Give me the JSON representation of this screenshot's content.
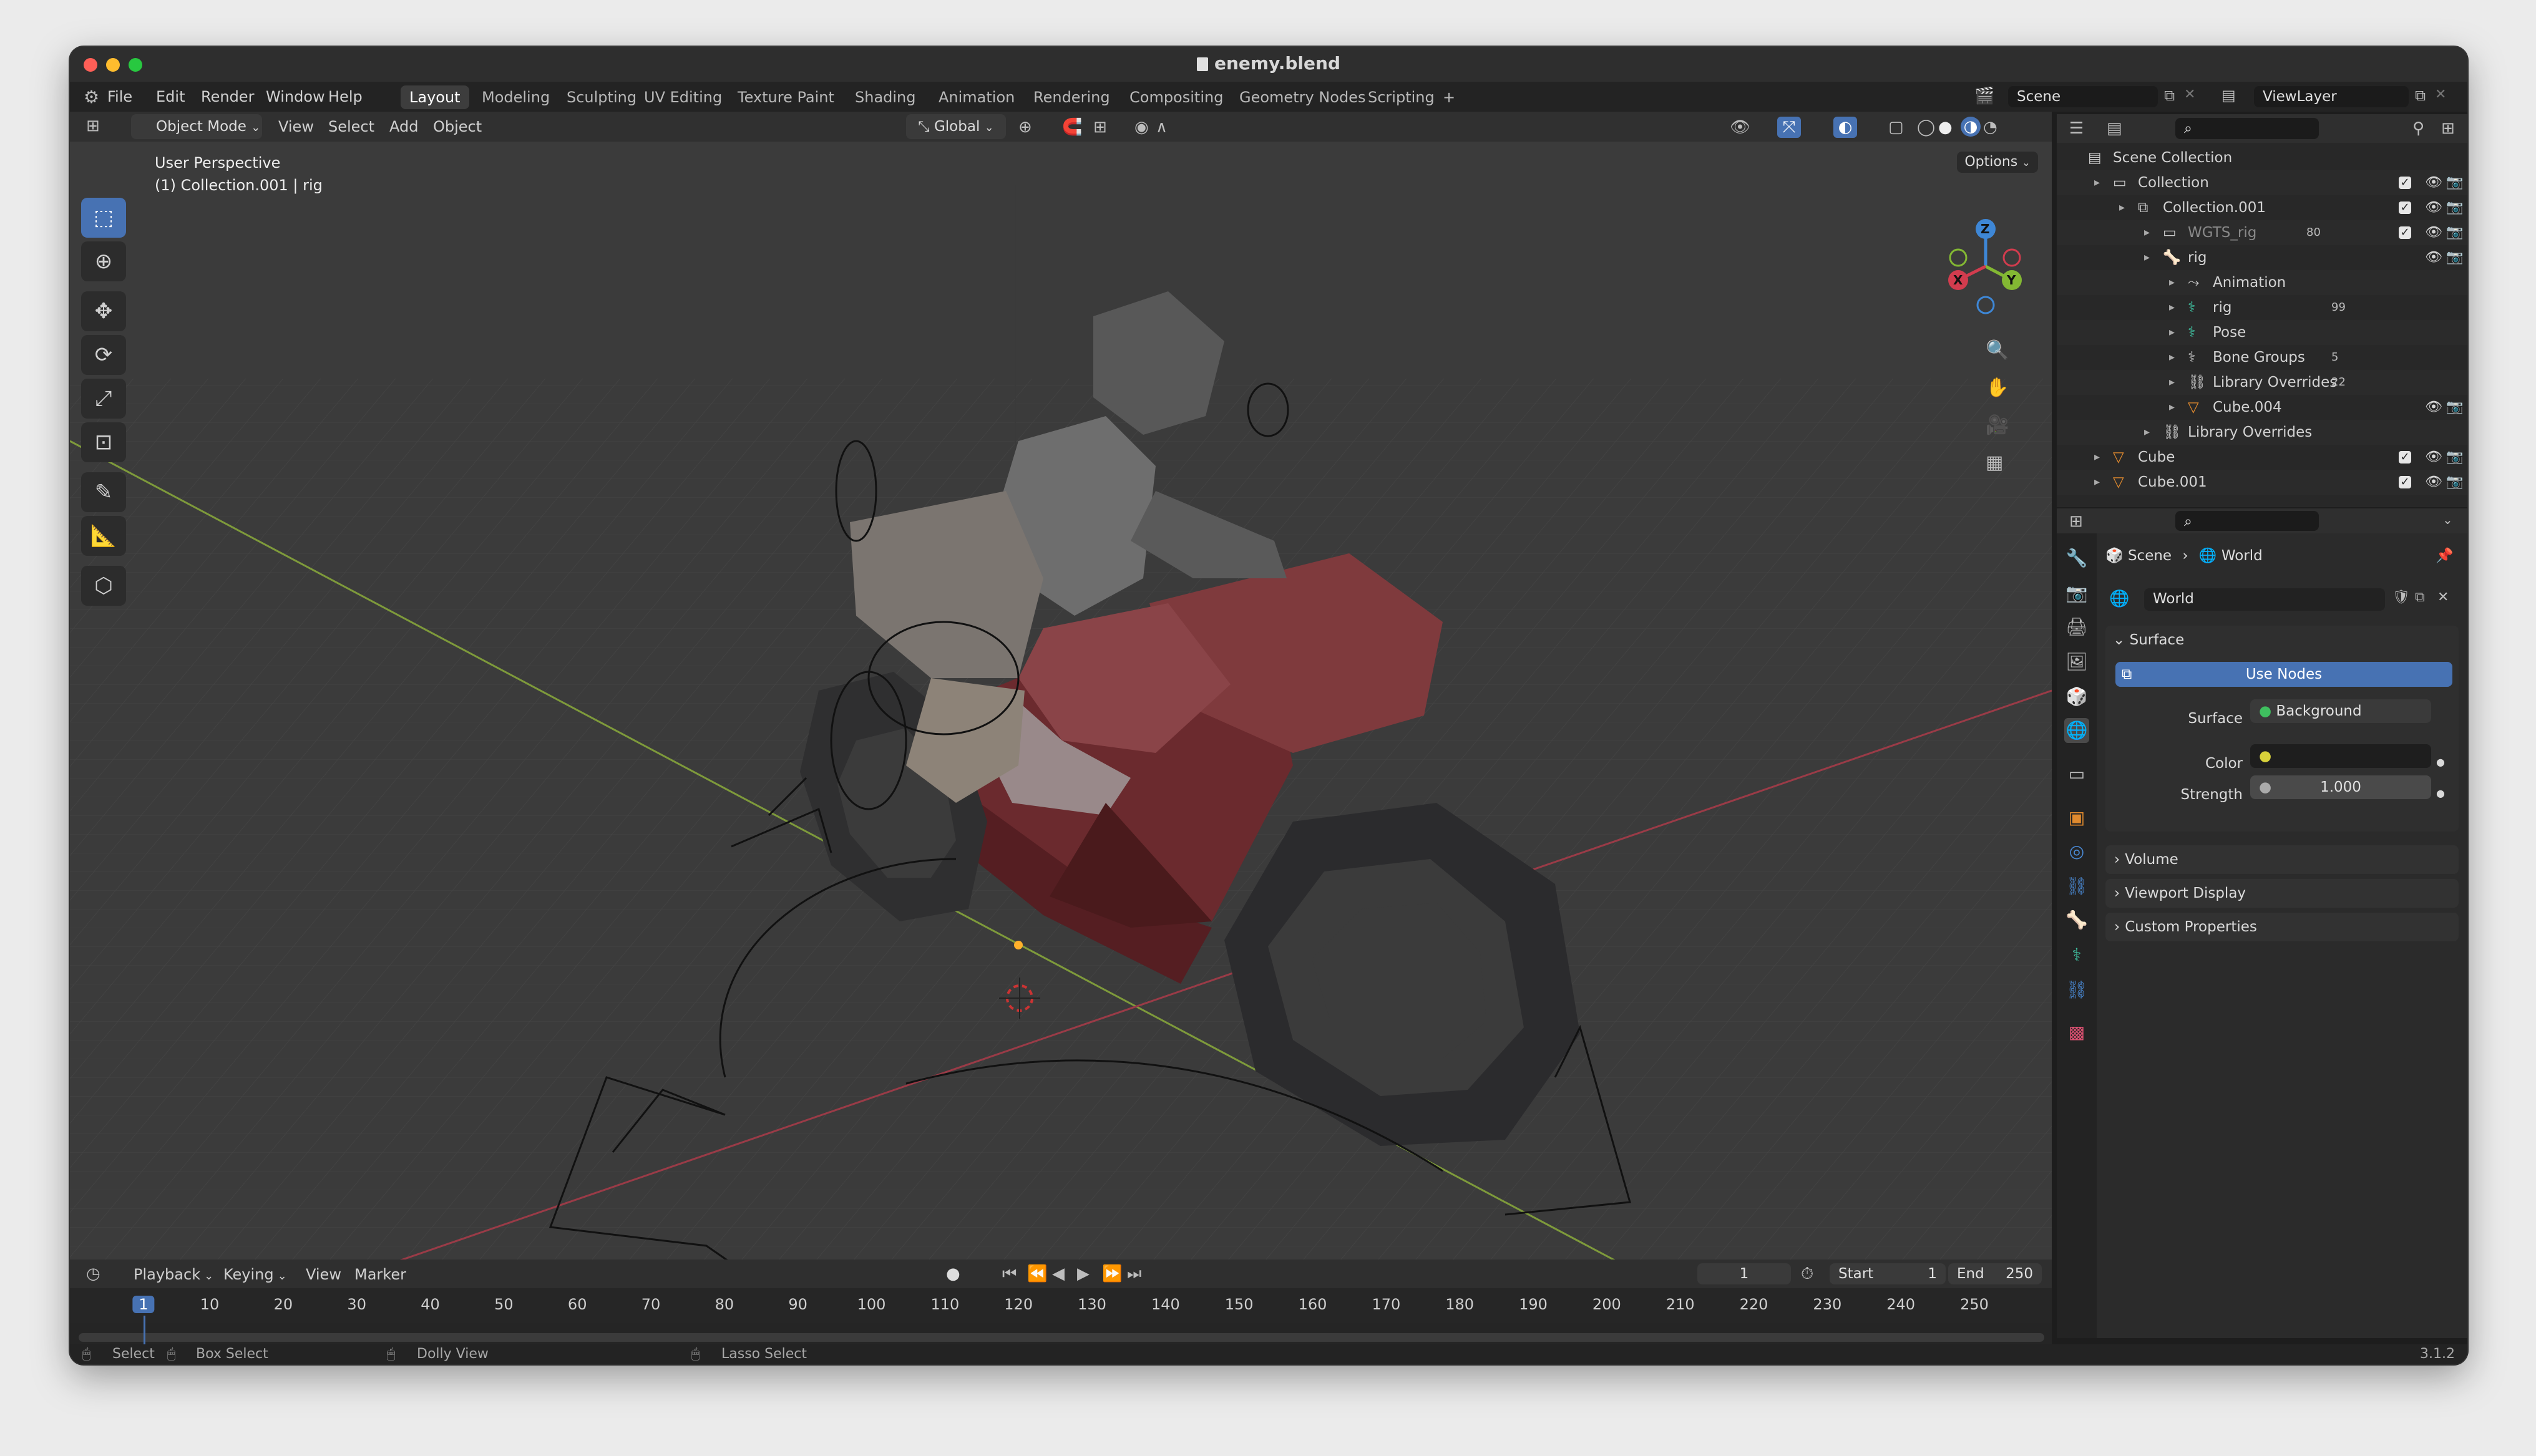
{
  "window": {
    "title": "enemy.blend"
  },
  "menu": [
    "File",
    "Edit",
    "Render",
    "Window",
    "Help"
  ],
  "workspaces": [
    {
      "label": "Layout",
      "active": true
    },
    {
      "label": "Modeling"
    },
    {
      "label": "Sculpting"
    },
    {
      "label": "UV Editing"
    },
    {
      "label": "Texture Paint"
    },
    {
      "label": "Shading"
    },
    {
      "label": "Animation"
    },
    {
      "label": "Rendering"
    },
    {
      "label": "Compositing"
    },
    {
      "label": "Geometry Nodes"
    },
    {
      "label": "Scripting"
    }
  ],
  "add_workspace": "+",
  "scene_field": "Scene",
  "viewlayer_field": "ViewLayer",
  "viewport_header": {
    "mode": "Object Mode",
    "menus": [
      "View",
      "Select",
      "Add",
      "Object"
    ],
    "orientation": "Global",
    "options": "Options"
  },
  "viewport": {
    "perspective": "User Perspective",
    "context": "(1) Collection.001 | rig",
    "axis_labels": {
      "x": "X",
      "y": "Y",
      "z": "Z"
    }
  },
  "outliner": {
    "rows": [
      {
        "label": "Scene Collection",
        "depth": 0,
        "icon": "scene-collection-icon"
      },
      {
        "label": "Collection",
        "depth": 1,
        "icon": "collection-icon"
      },
      {
        "label": "Collection.001",
        "depth": 2,
        "icon": "linked-collection-icon"
      },
      {
        "label": "WGTS_rig",
        "depth": 3,
        "icon": "collection-icon",
        "dim": true,
        "badge": "80"
      },
      {
        "label": "rig",
        "depth": 3,
        "icon": "armature-icon"
      },
      {
        "label": "Animation",
        "depth": 4,
        "icon": "animation-icon"
      },
      {
        "label": "rig",
        "depth": 4,
        "icon": "armature-data-icon",
        "badge": "99"
      },
      {
        "label": "Pose",
        "depth": 4,
        "icon": "pose-icon"
      },
      {
        "label": "Bone Groups",
        "depth": 4,
        "icon": "bone-groups-icon",
        "badge": "5"
      },
      {
        "label": "Library Overrides",
        "depth": 4,
        "icon": "library-overrides-icon",
        "badge": "22"
      },
      {
        "label": "Cube.004",
        "depth": 4,
        "icon": "mesh-icon"
      },
      {
        "label": "Library Overrides",
        "depth": 3,
        "icon": "library-overrides-icon"
      },
      {
        "label": "Cube",
        "depth": 1,
        "icon": "mesh-icon"
      },
      {
        "label": "Cube.001",
        "depth": 1,
        "icon": "mesh-icon"
      }
    ]
  },
  "properties": {
    "breadcrumb": [
      "Scene",
      "World"
    ],
    "world_name": "World",
    "surface_panel": "Surface",
    "use_nodes": "Use Nodes",
    "surface_label": "Surface",
    "surface_value": "Background",
    "color_label": "Color",
    "strength_label": "Strength",
    "strength_value": "1.000",
    "collapsed_panels": [
      "Volume",
      "Viewport Display",
      "Custom Properties"
    ]
  },
  "timeline": {
    "menus": [
      "Playback",
      "Keying",
      "View",
      "Marker"
    ],
    "current_frame": "1",
    "start_label": "Start",
    "start_value": "1",
    "end_label": "End",
    "end_value": "250",
    "ruler": [
      "1",
      "10",
      "20",
      "30",
      "40",
      "50",
      "60",
      "70",
      "80",
      "90",
      "100",
      "110",
      "120",
      "130",
      "140",
      "150",
      "160",
      "170",
      "180",
      "190",
      "200",
      "210",
      "220",
      "230",
      "240",
      "250"
    ]
  },
  "statusbar": {
    "items": [
      "Select",
      "Box Select",
      "Dolly View",
      "Lasso Select"
    ],
    "version": "3.1.2"
  },
  "colors": {
    "accent": "#4772b3",
    "active_frame": "#4772b3",
    "x_axis": "#d23c4e",
    "y_axis": "#83b833",
    "z_axis": "#3e87d6"
  }
}
